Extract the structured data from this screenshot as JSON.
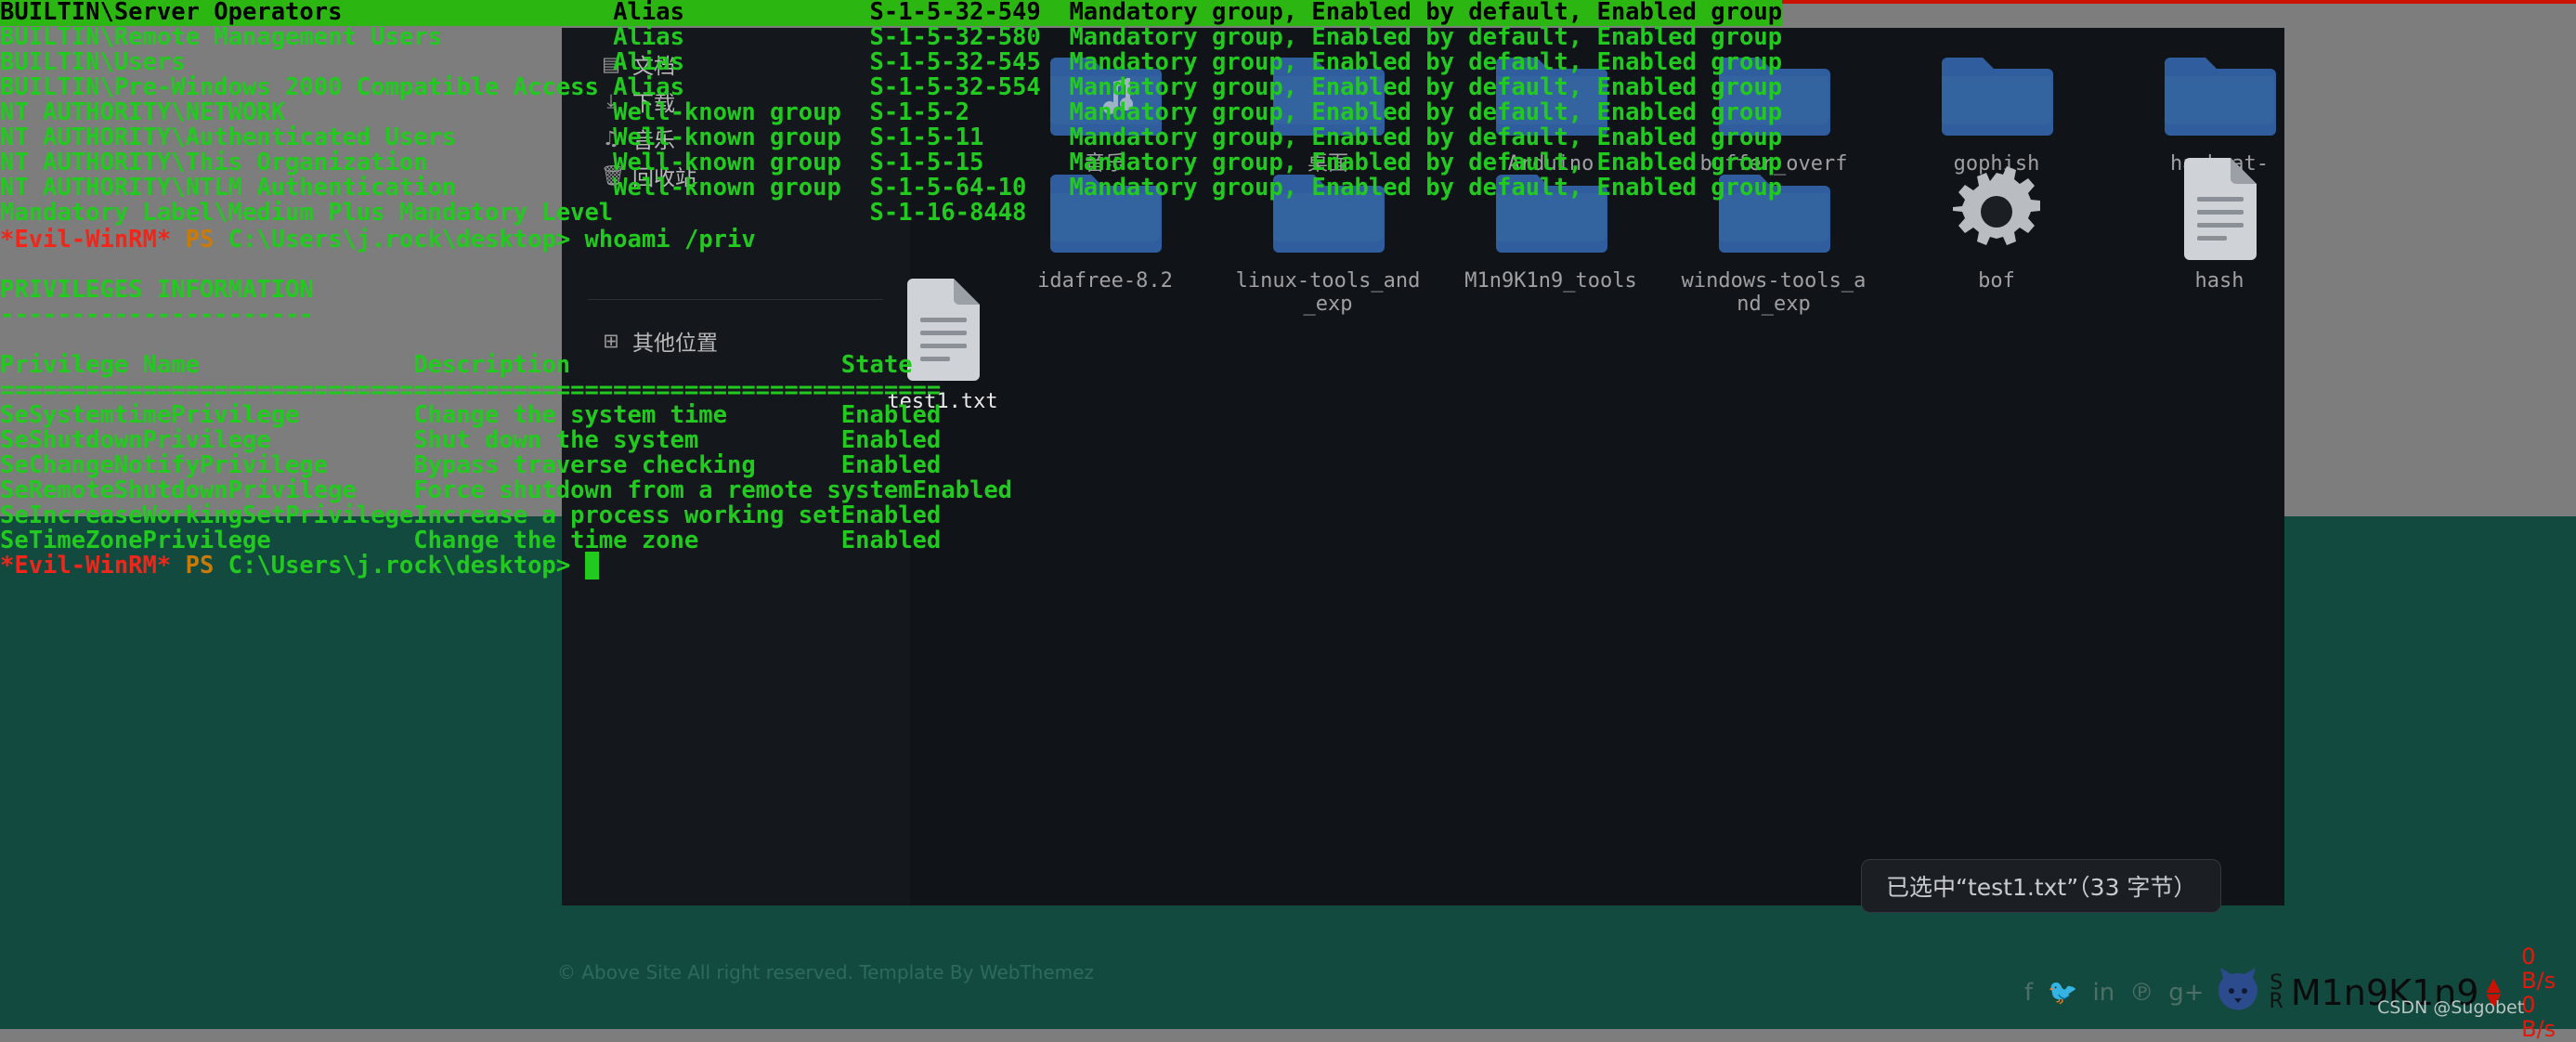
{
  "desktop": {
    "bg_upper_color": "#7d7d7d",
    "bg_lower_color": "#134a40",
    "accent_red": "#cc1100",
    "terminal_green": "#22c91f",
    "highlight_bg": "#2cb612"
  },
  "terminal": {
    "prompt_tag": "*Evil-WinRM*",
    "prompt_shell": "PS",
    "prompt_path": "C:\\Users\\j.rock\\desktop>",
    "command_groups": "whoami /priv",
    "groups_rows": [
      {
        "name": "BUILTIN\\Server Operators",
        "type": "Alias",
        "sid": "S-1-5-32-549",
        "attributes": "Mandatory group, Enabled by default, Enabled group",
        "highlighted": true
      },
      {
        "name": "BUILTIN\\Remote Management Users",
        "type": "Alias",
        "sid": "S-1-5-32-580",
        "attributes": "Mandatory group, Enabled by default, Enabled group",
        "highlighted": false
      },
      {
        "name": "BUILTIN\\Users",
        "type": "Alias",
        "sid": "S-1-5-32-545",
        "attributes": "Mandatory group, Enabled by default, Enabled group",
        "highlighted": false
      },
      {
        "name": "BUILTIN\\Pre-Windows 2000 Compatible Access",
        "type": "Alias",
        "sid": "S-1-5-32-554",
        "attributes": "Mandatory group, Enabled by default, Enabled group",
        "highlighted": false
      },
      {
        "name": "NT AUTHORITY\\NETWORK",
        "type": "Well-known group",
        "sid": "S-1-5-2",
        "attributes": "Mandatory group, Enabled by default, Enabled group",
        "highlighted": false
      },
      {
        "name": "NT AUTHORITY\\Authenticated Users",
        "type": "Well-known group",
        "sid": "S-1-5-11",
        "attributes": "Mandatory group, Enabled by default, Enabled group",
        "highlighted": false
      },
      {
        "name": "NT AUTHORITY\\This Organization",
        "type": "Well-known group",
        "sid": "S-1-5-15",
        "attributes": "Mandatory group, Enabled by default, Enabled group",
        "highlighted": false
      },
      {
        "name": "NT AUTHORITY\\NTLM Authentication",
        "type": "Well-known group",
        "sid": "S-1-5-64-10",
        "attributes": "Mandatory group, Enabled by default, Enabled group",
        "highlighted": false
      },
      {
        "name": "Mandatory Label\\Medium Plus Mandatory Level",
        "type": "",
        "sid": "S-1-16-8448",
        "attributes": "",
        "highlighted": false
      }
    ],
    "priv_heading": "PRIVILEGES INFORMATION",
    "priv_heading_rule": "----------------------",
    "priv_headers": {
      "name": "Privilege Name",
      "description": "Description",
      "state": "State"
    },
    "priv_header_rule": {
      "name": "=============================",
      "description": "==============================",
      "state": "======="
    },
    "priv_rows": [
      {
        "name": "SeSystemtimePrivilege",
        "description": "Change the system time",
        "state": "Enabled"
      },
      {
        "name": "SeShutdownPrivilege",
        "description": "Shut down the system",
        "state": "Enabled"
      },
      {
        "name": "SeChangeNotifyPrivilege",
        "description": "Bypass traverse checking",
        "state": "Enabled"
      },
      {
        "name": "SeRemoteShutdownPrivilege",
        "description": "Force shutdown from a remote system",
        "state": "Enabled"
      },
      {
        "name": "SeIncreaseWorkingSetPrivilege",
        "description": "Increase a process working set",
        "state": "Enabled"
      },
      {
        "name": "SeTimeZonePrivilege",
        "description": "Change the time zone",
        "state": "Enabled"
      }
    ]
  },
  "file_manager": {
    "places": [
      {
        "label": "文档",
        "icon": "document-icon"
      },
      {
        "label": "下载",
        "icon": "download-icon"
      },
      {
        "label": "音乐",
        "icon": "music-note-icon"
      },
      {
        "label": "回收站",
        "icon": "trash-icon"
      },
      {
        "label": "其他位置",
        "icon": "places-icon"
      }
    ],
    "items": [
      {
        "label": "音乐",
        "icon": "folder-music-icon",
        "selected": false
      },
      {
        "label": "桌面",
        "icon": "folder-icon",
        "selected": false
      },
      {
        "label": "Arduino",
        "icon": "folder-icon",
        "selected": false
      },
      {
        "label": "buffer_overf",
        "icon": "folder-icon",
        "selected": false
      },
      {
        "label": "gophish",
        "icon": "folder-icon",
        "selected": false
      },
      {
        "label": "hashcat-",
        "icon": "folder-icon",
        "selected": false
      },
      {
        "label": "idafree-8.2",
        "icon": "folder-icon",
        "selected": false
      },
      {
        "label": "linux-tools_and_exp",
        "icon": "folder-icon",
        "selected": false
      },
      {
        "label": "M1n9K1n9_tools",
        "icon": "folder-icon",
        "selected": false
      },
      {
        "label": "windows-tools_and_exp",
        "icon": "folder-icon",
        "selected": false
      },
      {
        "label": "bof",
        "icon": "gear-file-icon",
        "selected": false
      },
      {
        "label": "hash",
        "icon": "text-file-icon",
        "selected": false
      },
      {
        "label": "test1.txt",
        "icon": "text-file-icon",
        "selected": true
      }
    ],
    "status_toast": "已选中“test1.txt”（33 字节）"
  },
  "watermarks": {
    "template_credit": "© Above Site All right reserved. Template By WebThemez",
    "csdn": "CSDN @Sugobet"
  },
  "taskbar": {
    "social_icons": [
      "facebook-icon",
      "twitter-icon",
      "linkedin-icon",
      "pinterest-icon",
      "googleplus-icon"
    ],
    "username": "M1n9K1n9",
    "sr_label_top": "S",
    "sr_label_bottom": "R",
    "upload_speed": "0 B/s",
    "download_speed": "0 B/s"
  }
}
